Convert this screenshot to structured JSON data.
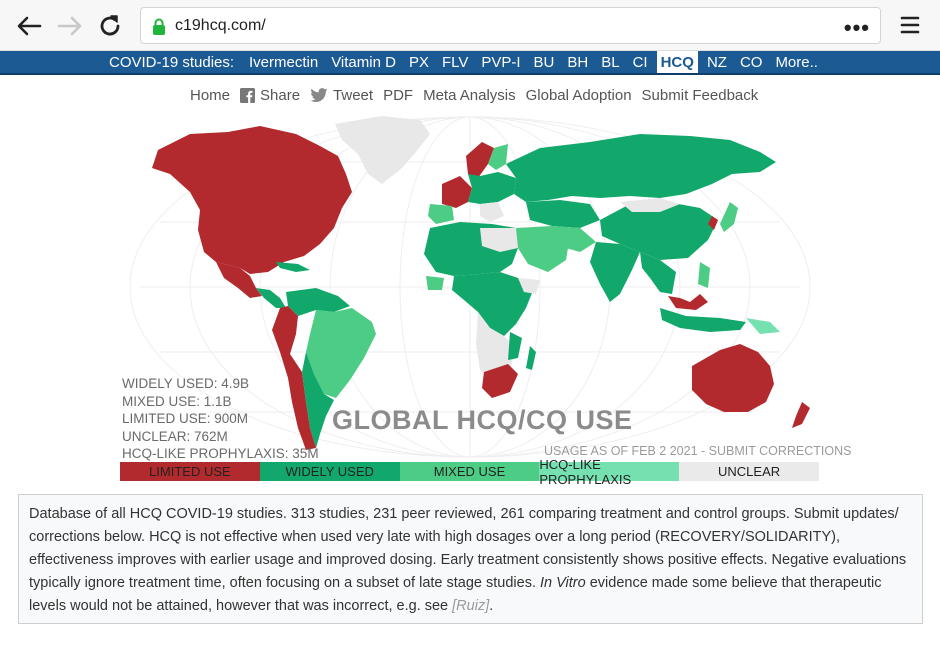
{
  "browser": {
    "url": "c19hcq.com/",
    "more_label": "•••"
  },
  "topnav": {
    "label": "COVID-19 studies:",
    "items": [
      {
        "label": "Ivermectin",
        "active": false
      },
      {
        "label": "Vitamin D",
        "active": false
      },
      {
        "label": "PX",
        "active": false
      },
      {
        "label": "FLV",
        "active": false
      },
      {
        "label": "PVP-I",
        "active": false
      },
      {
        "label": "BU",
        "active": false
      },
      {
        "label": "BH",
        "active": false
      },
      {
        "label": "BL",
        "active": false
      },
      {
        "label": "CI",
        "active": false
      },
      {
        "label": "HCQ",
        "active": true
      },
      {
        "label": "NZ",
        "active": false
      },
      {
        "label": "CO",
        "active": false
      },
      {
        "label": "More..",
        "active": false
      }
    ]
  },
  "subnav": {
    "items": [
      {
        "label": "Home",
        "icon": ""
      },
      {
        "label": "Share",
        "icon": "facebook-icon"
      },
      {
        "label": "Tweet",
        "icon": "twitter-icon"
      },
      {
        "label": "PDF",
        "icon": ""
      },
      {
        "label": "Meta Analysis",
        "icon": ""
      },
      {
        "label": "Global Adoption",
        "icon": ""
      },
      {
        "label": "Submit Feedback",
        "icon": ""
      }
    ]
  },
  "map": {
    "stats": [
      "WIDELY USED: 4.9B",
      "MIXED USE: 1.1B",
      "LIMITED USE: 900M",
      "UNCLEAR: 762M",
      "HCQ-LIKE PROPHYLAXIS: 35M"
    ],
    "title": "GLOBAL HCQ/CQ USE",
    "subtitle": "USAGE AS OF FEB 2 2021 - SUBMIT CORRECTIONS",
    "colors": {
      "limited": "#b22a2e",
      "widely": "#12a86c",
      "mixed": "#4ccc84",
      "prophylaxis": "#75e0b0",
      "unclear": "#e8e8e8"
    },
    "legend": [
      {
        "label": "LIMITED USE",
        "color": "#b22a2e"
      },
      {
        "label": "WIDELY USED",
        "color": "#12a86c"
      },
      {
        "label": "MIXED USE",
        "color": "#4ccc84"
      },
      {
        "label": "HCQ-LIKE PROPHYLAXIS",
        "color": "#75e0b0"
      },
      {
        "label": "UNCLEAR",
        "color": "#eaeaea"
      }
    ]
  },
  "description": {
    "text1": "Database of all HCQ COVID-19 studies. 313 studies, 231 peer reviewed, 261 comparing treatment and control groups. Submit updates/ corrections below. HCQ is not effective when used very late with high dosages over a long period (RECOVERY/SOLIDARITY), effectiveness improves with earlier usage and improved dosing. Early treatment consistently shows positive effects. Negative evaluations typically ignore treatment time, often focusing on a subset of late stage studies. ",
    "italic": "In Vitro",
    "text2": " evidence made some believe that therapeutic levels would not be attained, however that was incorrect, e.g. see ",
    "cite": "[Ruiz]",
    "text3": "."
  }
}
